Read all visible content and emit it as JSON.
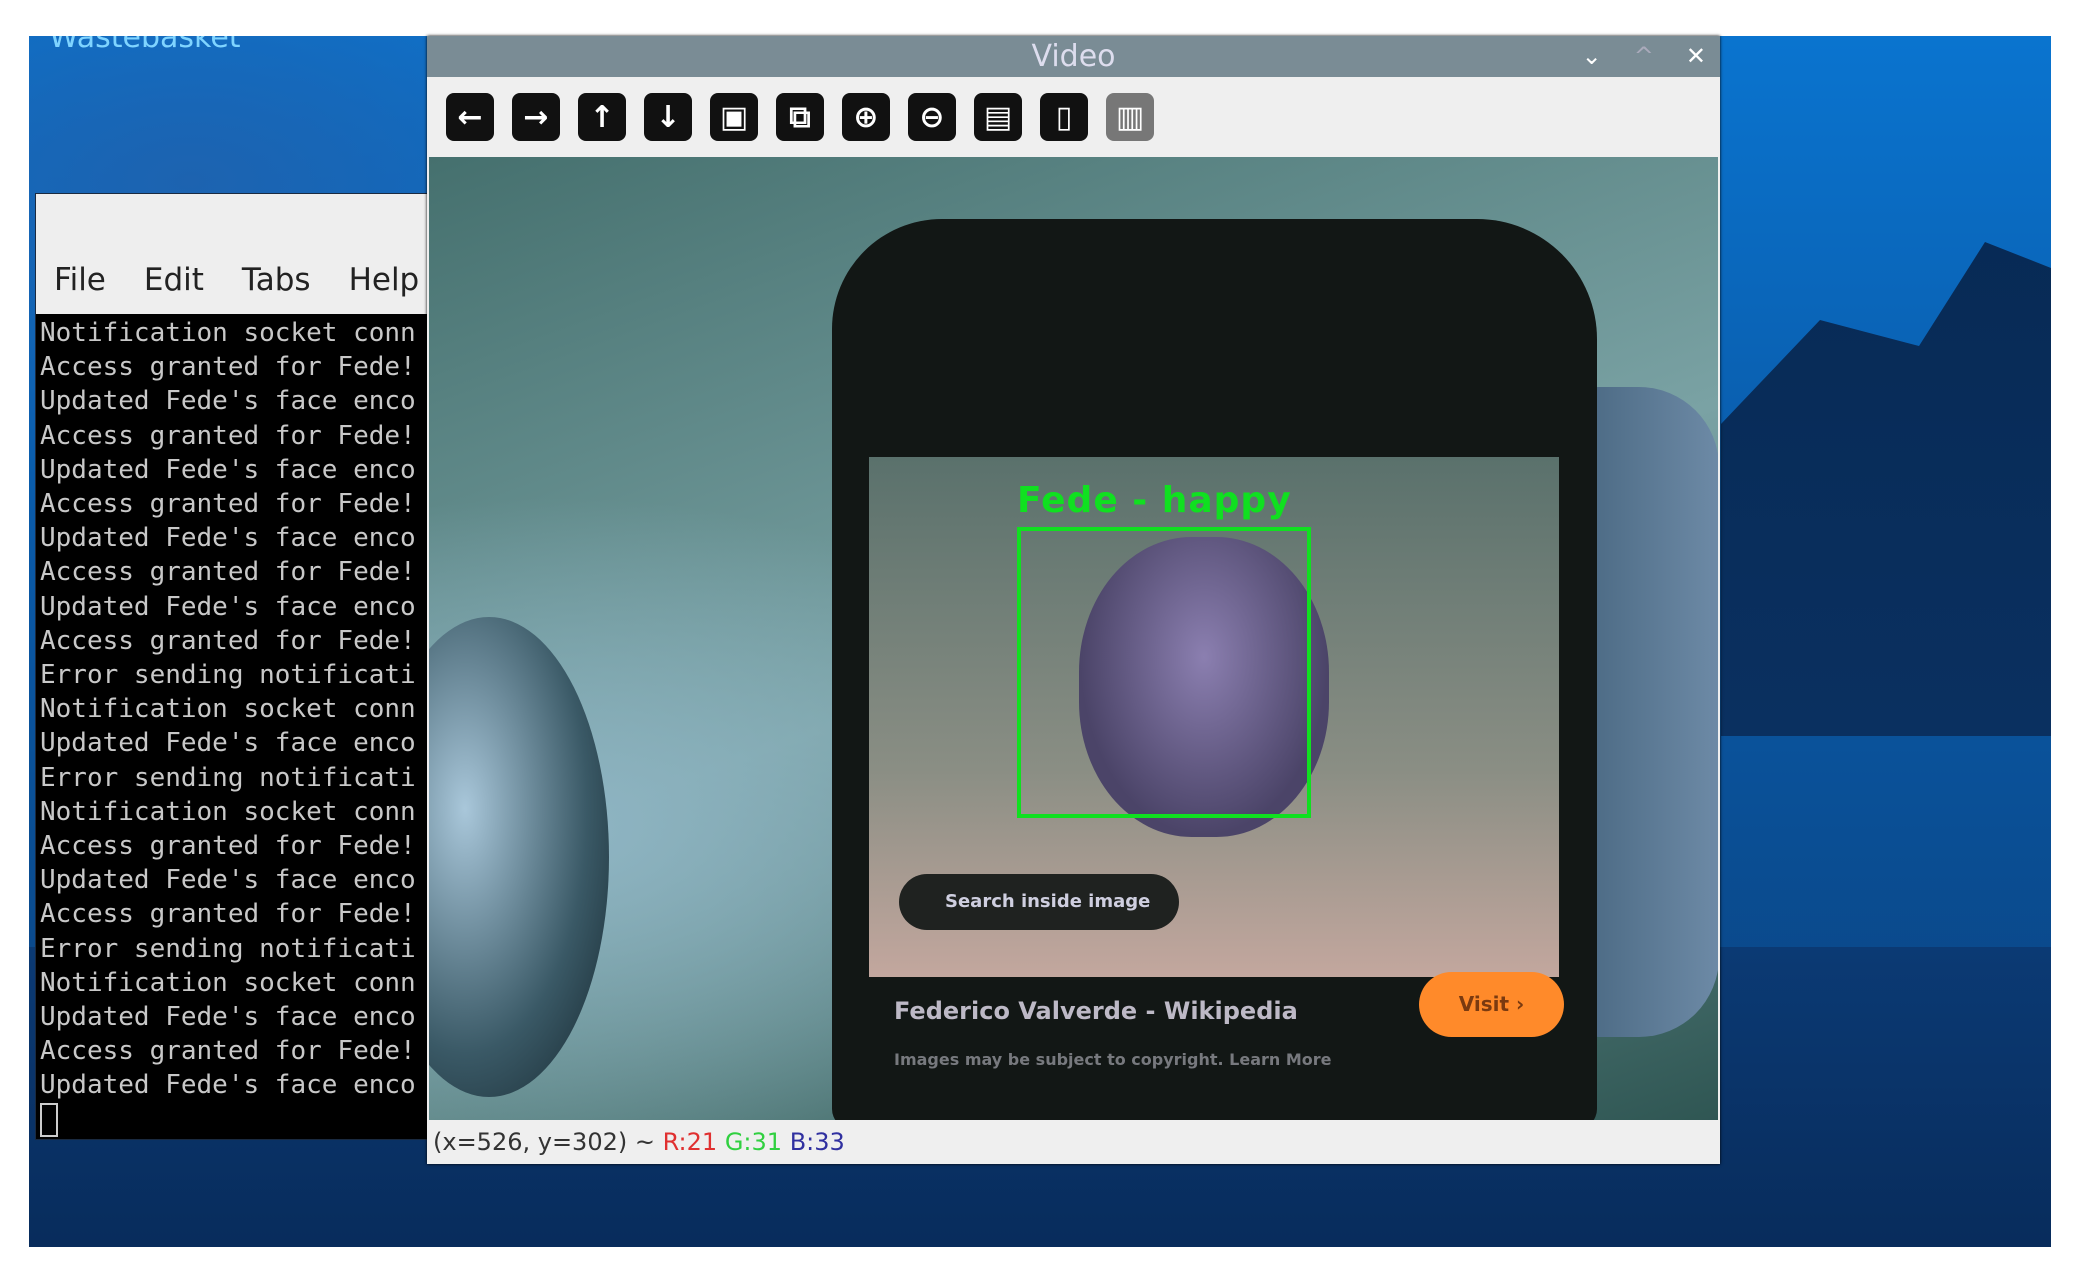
{
  "desktop": {
    "wastebasket_label": "Wastebasket"
  },
  "terminal": {
    "menu": [
      "File",
      "Edit",
      "Tabs",
      "Help"
    ],
    "lines": [
      "Notification socket conn",
      "Access granted for Fede!",
      "Updated Fede's face enco",
      "Access granted for Fede!",
      "Updated Fede's face enco",
      "Access granted for Fede!",
      "Updated Fede's face enco",
      "Access granted for Fede!",
      "Updated Fede's face enco",
      "Access granted for Fede!",
      "Error sending notificati",
      "Notification socket conn",
      "Updated Fede's face enco",
      "Error sending notificati",
      "Notification socket conn",
      "Access granted for Fede!",
      "Updated Fede's face enco",
      "Access granted for Fede!",
      "Error sending notificati",
      "Notification socket conn",
      "Updated Fede's face enco",
      "Access granted for Fede!",
      "Updated Fede's face enco"
    ]
  },
  "video": {
    "title": "Video",
    "window_buttons": {
      "minimize": "⌄",
      "maximize": "^",
      "close": "✕"
    },
    "toolbar": [
      {
        "name": "pan-left-icon",
        "glyph": "←"
      },
      {
        "name": "pan-right-icon",
        "glyph": "→"
      },
      {
        "name": "pan-up-icon",
        "glyph": "↑"
      },
      {
        "name": "pan-down-icon",
        "glyph": "↓"
      },
      {
        "name": "zoom-reset-icon",
        "glyph": "▣"
      },
      {
        "name": "zoom-fit-icon",
        "glyph": "⧉"
      },
      {
        "name": "zoom-in-icon",
        "glyph": "⊕"
      },
      {
        "name": "zoom-out-icon",
        "glyph": "⊖"
      },
      {
        "name": "save-icon",
        "glyph": "▤"
      },
      {
        "name": "copy-clipboard-icon",
        "glyph": "▯"
      },
      {
        "name": "properties-icon",
        "glyph": "▥"
      }
    ],
    "detection_label": "Fede - happy",
    "photo_text": {
      "search": "Search inside image",
      "wiki": "Federico Valverde - Wikipedia",
      "copyright": "Images may be subject to copyright. Learn More",
      "visit": "Visit ›"
    },
    "status": {
      "coords": "(x=526, y=302) ~",
      "r": "R:21",
      "g": "G:31",
      "b": "B:33"
    },
    "colors": {
      "r": "#e03030",
      "g": "#30d040",
      "b": "#3030a0",
      "box": "#10e020"
    }
  }
}
